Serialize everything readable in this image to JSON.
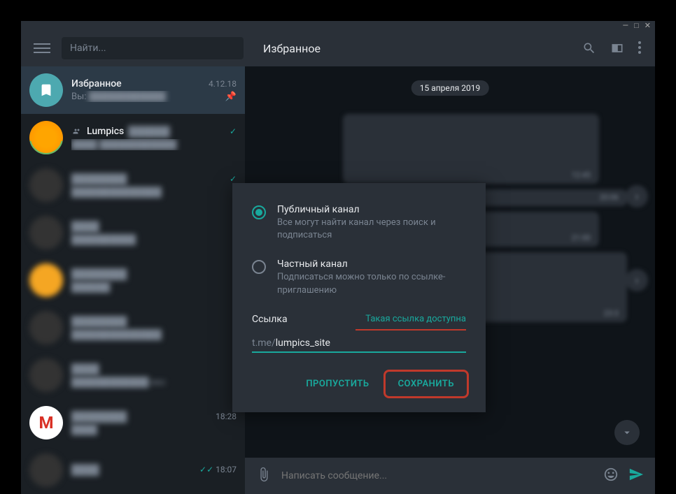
{
  "titlebar": {
    "min": "—",
    "max": "□",
    "close": "✕"
  },
  "header": {
    "search_placeholder": "Найти...",
    "chat_title": "Избранное"
  },
  "sidebar": {
    "items": [
      {
        "name": "Избранное",
        "date": "4.12.18",
        "preview_prefix": "Вы:",
        "pinned": true
      },
      {
        "name": "Lumpics",
        "date": "",
        "preview_prefix": "",
        "group": true
      },
      {
        "name": "",
        "date": "",
        "preview_prefix": ""
      },
      {
        "name": "",
        "date": "",
        "preview_prefix": ""
      },
      {
        "name": "",
        "date": "",
        "preview_prefix": ""
      },
      {
        "name": "",
        "date": "",
        "preview_prefix": ""
      },
      {
        "name": "",
        "date": "",
        "preview_prefix": ""
      },
      {
        "name": "",
        "date": "18:28",
        "preview_prefix": ""
      },
      {
        "name": "",
        "date": "18:07",
        "preview_prefix": ""
      }
    ]
  },
  "main": {
    "date_badge": "15 апреля 2019",
    "msg_times": [
      "12:45",
      "20:06",
      "21:00",
      "23:3"
    ]
  },
  "composer": {
    "placeholder": "Написать сообщение..."
  },
  "modal": {
    "public": {
      "title": "Публичный канал",
      "desc": "Все могут найти канал через поиск и подписаться"
    },
    "private": {
      "title": "Частный канал",
      "desc": "Подписаться можно только по ссылке-приглашению"
    },
    "link_label": "Ссылка",
    "link_status": "Такая ссылка доступна",
    "link_prefix": "t.me/",
    "link_value": "lumpics_site",
    "skip": "ПРОПУСТИТЬ",
    "save": "СОХРАНИТЬ"
  }
}
